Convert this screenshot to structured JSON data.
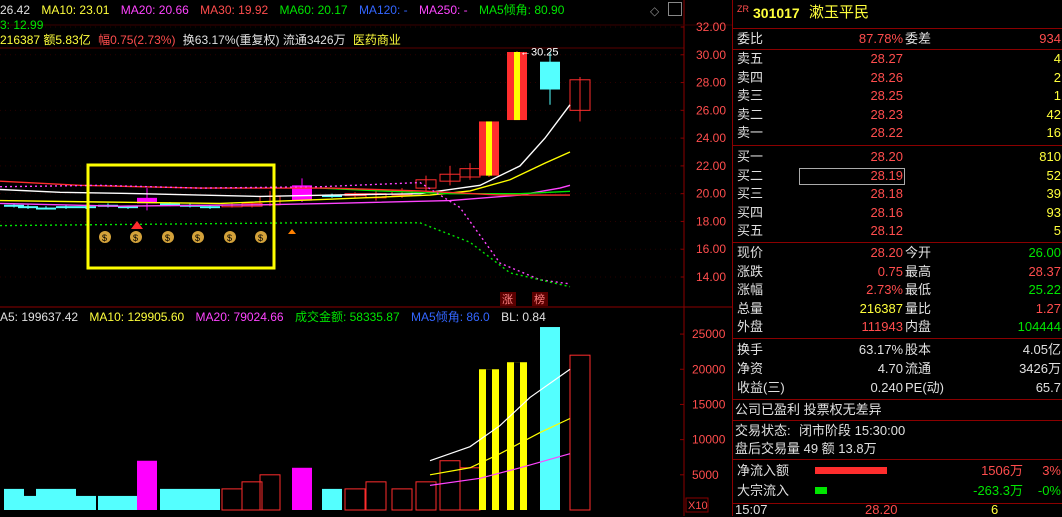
{
  "chart": {
    "top_info": {
      "ma5": "26.42",
      "ma10": "MA10: 23.01",
      "ma20": "MA20: 20.66",
      "ma30": "MA30: 19.92",
      "ma60": "MA60: 20.17",
      "ma120": "MA120: -",
      "ma250": "MA250: -",
      "ma5_slope": "MA5倾角: 80.90",
      "line2": "3: 12.99",
      "amount_line": "216387 额5.83亿",
      "change_label": "幅0.75(2.73%)",
      "turnover_line": "换63.17%(重复权) 流通3426万",
      "sector": "医药商业"
    },
    "vol_info": {
      "ma5": "A5: 199637.42",
      "ma10": "MA10: 129905.60",
      "ma20": "MA20: 79024.66",
      "amount": "成交金额: 58335.87",
      "ma5_slope": "MA5倾角: 86.0",
      "bl": "BL: 0.84"
    },
    "price_axis": [
      "32.00",
      "30.00",
      "28.00",
      "26.00",
      "24.00",
      "22.00",
      "20.00",
      "18.00",
      "16.00",
      "14.00"
    ],
    "vol_axis": [
      "25000",
      "20000",
      "15000",
      "10000",
      "5000"
    ],
    "vol_unit": "X10",
    "peak_label": "30.25",
    "tags": [
      "涨",
      "榜"
    ],
    "colors": {
      "up": "#ff2d2d",
      "down": "#54ffff",
      "ma5": "#ffffff",
      "ma10": "#ffff00",
      "ma20": "#ff44ff",
      "ma60": "#00e600",
      "highlight_box": "#ffff00"
    }
  },
  "quote": {
    "code_prefix": "ZR",
    "code": "301017",
    "name": "漱玉平民",
    "ratio_label": "委比",
    "ratio_value": "87.78%",
    "diff_label": "委差",
    "diff_value": "934",
    "sell": [
      {
        "label": "卖五",
        "price": "28.27",
        "vol": "4"
      },
      {
        "label": "卖四",
        "price": "28.26",
        "vol": "2"
      },
      {
        "label": "卖三",
        "price": "28.25",
        "vol": "1"
      },
      {
        "label": "卖二",
        "price": "28.23",
        "vol": "42"
      },
      {
        "label": "卖一",
        "price": "28.22",
        "vol": "16"
      }
    ],
    "buy": [
      {
        "label": "买一",
        "price": "28.20",
        "vol": "810"
      },
      {
        "label": "买二",
        "price": "28.19",
        "vol": "52"
      },
      {
        "label": "买三",
        "price": "28.18",
        "vol": "39"
      },
      {
        "label": "买四",
        "price": "28.16",
        "vol": "93"
      },
      {
        "label": "买五",
        "price": "28.12",
        "vol": "5"
      }
    ],
    "stats": [
      {
        "l1": "现价",
        "v1": "28.20",
        "l2": "今开",
        "v2": "26.00",
        "c1": "red",
        "c2": "green"
      },
      {
        "l1": "涨跌",
        "v1": "0.75",
        "l2": "最高",
        "v2": "28.37",
        "c1": "red",
        "c2": "red"
      },
      {
        "l1": "涨幅",
        "v1": "2.73%",
        "l2": "最低",
        "v2": "25.22",
        "c1": "red",
        "c2": "green"
      },
      {
        "l1": "总量",
        "v1": "216387",
        "l2": "量比",
        "v2": "1.27",
        "c1": "yellow",
        "c2": "red"
      },
      {
        "l1": "外盘",
        "v1": "111943",
        "l2": "内盘",
        "v2": "104444",
        "c1": "red",
        "c2": "green"
      }
    ],
    "stats2": [
      {
        "l1": "换手",
        "v1": "63.17%",
        "l2": "股本",
        "v2": "4.05亿"
      },
      {
        "l1": "净资",
        "v1": "4.70",
        "l2": "流通",
        "v2": "3426万"
      },
      {
        "l1": "收益(三)",
        "v1": "0.240",
        "l2": "PE(动)",
        "v2": "65.7"
      }
    ],
    "profit_note": "公司已盈利 投票权无差异",
    "status_label": "交易状态:",
    "status_value": "闭市阶段 15:30:00",
    "after_hours": "盘后交易量 49 额 13.8万",
    "flow": [
      {
        "label": "净流入额",
        "value": "1506万",
        "pct": "3%",
        "color": "red"
      },
      {
        "label": "大宗流入",
        "value": "-263.3万",
        "pct": "-0%",
        "color": "green"
      }
    ],
    "bottom_time": "15:07",
    "bottom_price": "28.20",
    "bottom_vol": "6"
  }
}
